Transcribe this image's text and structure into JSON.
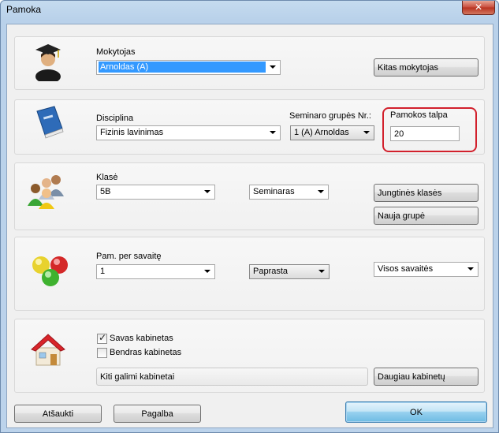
{
  "window": {
    "title": "Pamoka",
    "close_symbol": "✕"
  },
  "teacher": {
    "label": "Mokytojas",
    "value": "Arnoldas (A)",
    "other_button": "Kitas mokytojas"
  },
  "discipline": {
    "label": "Disciplina",
    "value": "Fizinis lavinimas",
    "seminar_label": "Seminaro grupės Nr.:",
    "seminar_value": "1 (A) Arnoldas",
    "capacity_label": "Pamokos talpa",
    "capacity_value": "20"
  },
  "class": {
    "label": "Klasė",
    "value": "5B",
    "type_value": "Seminaras",
    "joined_button": "Jungtinės klasės",
    "new_group_button": "Nauja grupė"
  },
  "schedule": {
    "label": "Pam. per savaitę",
    "per_week_value": "1",
    "kind_value": "Paprasta",
    "weeks_value": "Visos savaitės"
  },
  "rooms": {
    "own_label": "Savas kabinetas",
    "own_checked": true,
    "shared_label": "Bendras kabinetas",
    "shared_checked": false,
    "other_button": "Kiti galimi kabinetai",
    "more_button": "Daugiau kabinetų"
  },
  "footer": {
    "cancel": "Atšaukti",
    "help": "Pagalba",
    "ok": "OK"
  },
  "icons": {
    "teacher": "graduate-icon",
    "discipline": "book-icon",
    "class": "people-icon",
    "schedule": "balls-icon",
    "rooms": "house-icon"
  },
  "colors": {
    "selection": "#3399ff",
    "highlight_frame": "#d2202c"
  }
}
